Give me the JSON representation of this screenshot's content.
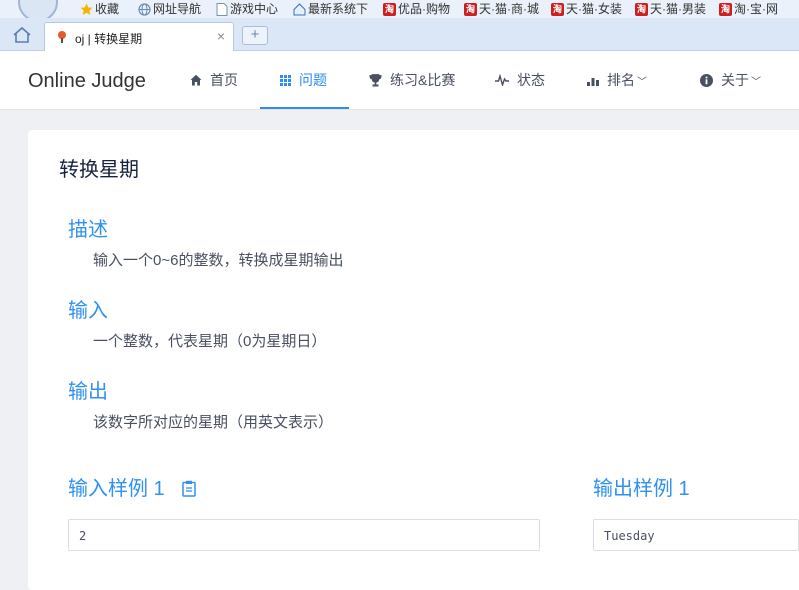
{
  "bookmarks": [
    {
      "label": "收藏",
      "icon": "star-icon"
    },
    {
      "label": "网址导航",
      "icon": "globe-icon"
    },
    {
      "label": "游戏中心",
      "icon": "page-icon"
    },
    {
      "label": "最新系统下",
      "icon": "house-icon"
    },
    {
      "label": "优品·购物",
      "icon": "taobao-icon"
    },
    {
      "label": "天·猫·商·城",
      "icon": "taobao-icon"
    },
    {
      "label": "天·猫·女装",
      "icon": "taobao-icon"
    },
    {
      "label": "天·猫·男装",
      "icon": "taobao-icon"
    },
    {
      "label": "淘·宝·网",
      "icon": "taobao-icon"
    }
  ],
  "tab": {
    "title": "oj | 转换星期",
    "close": "×"
  },
  "new_tab_label": "+",
  "brand": "Online Judge",
  "nav": [
    {
      "label": "首页",
      "icon": "home-icon"
    },
    {
      "label": "问题",
      "icon": "grid-icon",
      "active": true
    },
    {
      "label": "练习&比赛",
      "icon": "trophy-icon"
    },
    {
      "label": "状态",
      "icon": "pulse-icon"
    },
    {
      "label": "排名",
      "icon": "bar-chart-icon",
      "dropdown": true
    },
    {
      "label": "关于",
      "icon": "info-icon",
      "dropdown": true
    }
  ],
  "problem": {
    "title": "转换星期",
    "description_title": "描述",
    "description": "输入一个0~6的整数，转换成星期输出",
    "input_title": "输入",
    "input": "一个整数，代表星期（0为星期日）",
    "output_title": "输出",
    "output": "该数字所对应的星期（用英文表示）",
    "sample_input_title": "输入样例 1",
    "sample_output_title": "输出样例 1",
    "sample_input": "2",
    "sample_output": "Tuesday"
  },
  "colors": {
    "accent": "#2d8cf0",
    "section": "#3091f2",
    "text": "#495060"
  }
}
